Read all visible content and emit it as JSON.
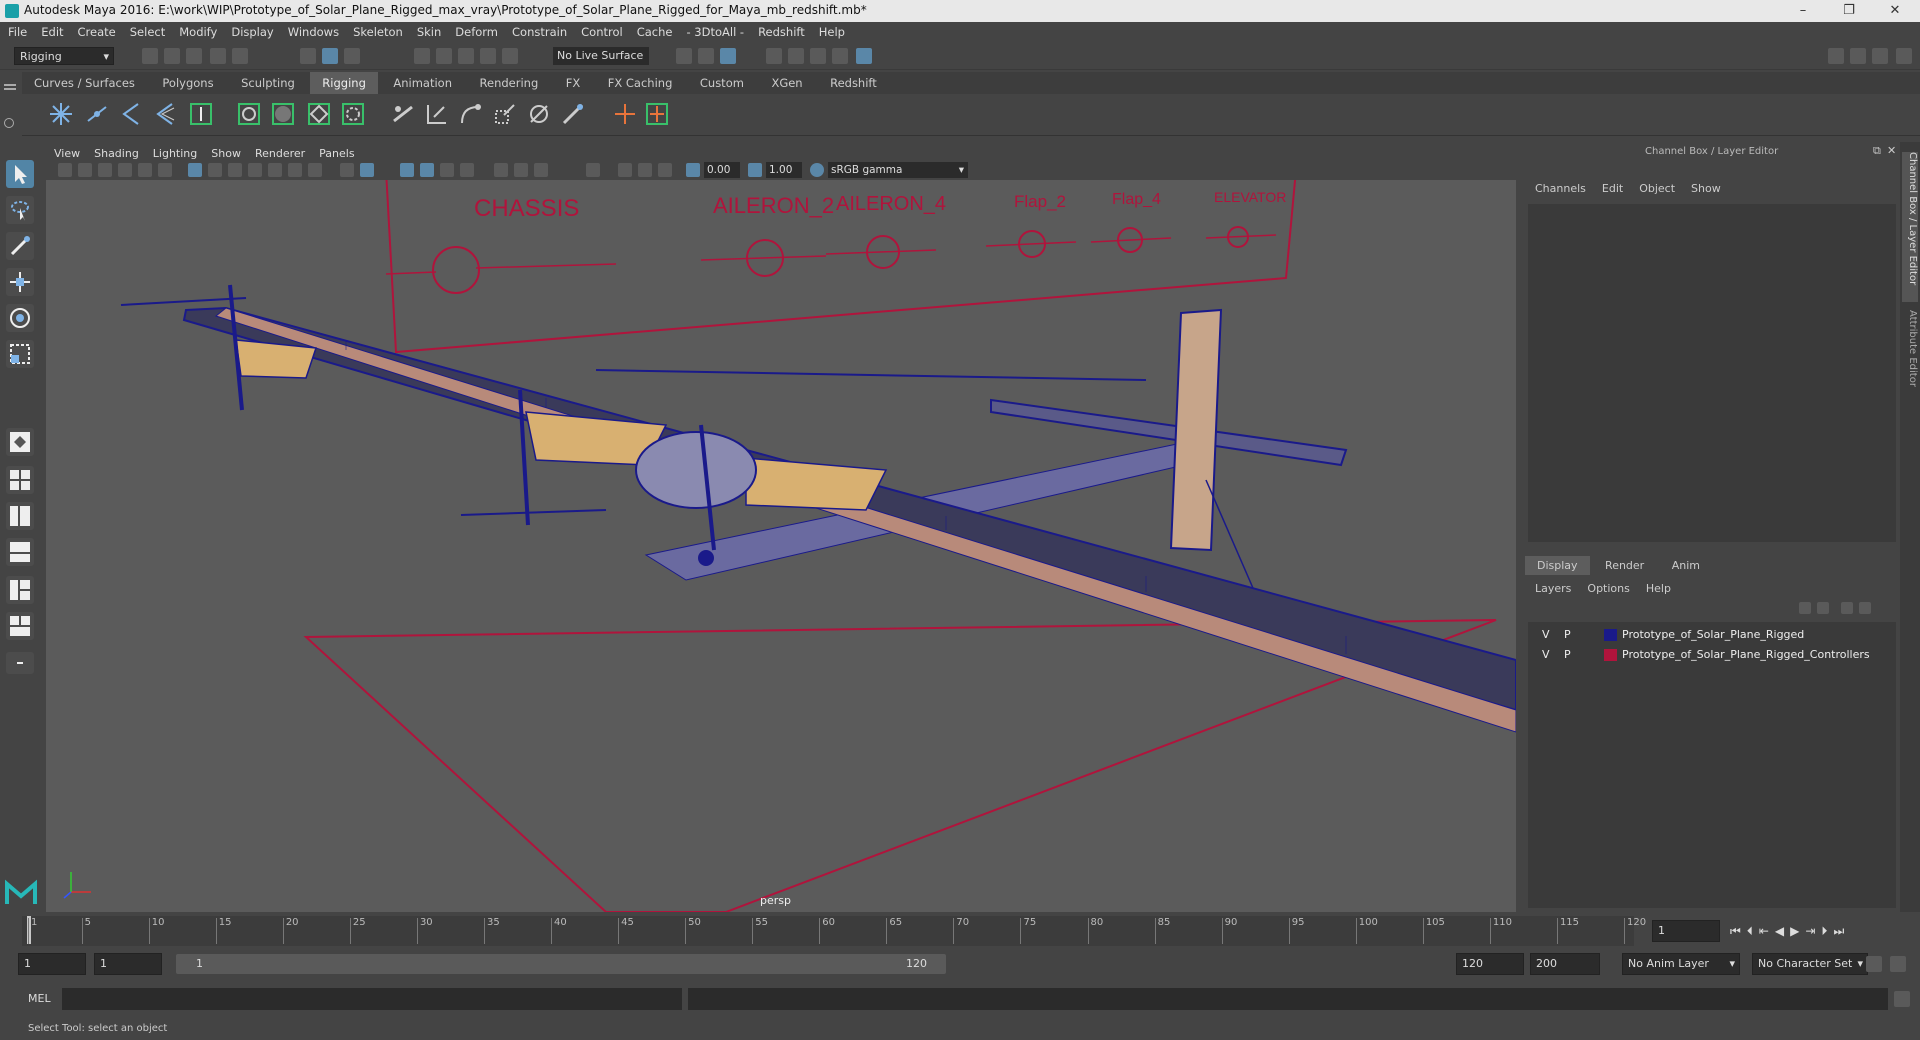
{
  "window": {
    "title": "Autodesk Maya 2016: E:\\work\\WIP\\Prototype_of_Solar_Plane_Rigged_max_vray\\Prototype_of_Solar_Plane_Rigged_for_Maya_mb_redshift.mb*"
  },
  "menubar": [
    "File",
    "Edit",
    "Create",
    "Select",
    "Modify",
    "Display",
    "Windows",
    "Skeleton",
    "Skin",
    "Deform",
    "Constrain",
    "Control",
    "Cache",
    "- 3DtoAll -",
    "Redshift",
    "Help"
  ],
  "statusline": {
    "mode": "Rigging",
    "live_surface": "No Live Surface"
  },
  "shelf_tabs": [
    "Curves / Surfaces",
    "Polygons",
    "Sculpting",
    "Rigging",
    "Animation",
    "Rendering",
    "FX",
    "FX Caching",
    "Custom",
    "XGen",
    "Redshift"
  ],
  "shelf_active": "Rigging",
  "viewport": {
    "menu": [
      "View",
      "Shading",
      "Lighting",
      "Show",
      "Renderer",
      "Panels"
    ],
    "exposure": "0.00",
    "gamma": "1.00",
    "color_space": "sRGB gamma",
    "camera_label": "persp",
    "controller_labels": [
      "CHASSIS",
      "AILERON_2",
      "AILERON_4",
      "Flap_2",
      "Flap_4",
      "ELEVATOR"
    ]
  },
  "right_panel": {
    "title": "Channel Box / Layer Editor",
    "menu": [
      "Channels",
      "Edit",
      "Object",
      "Show"
    ],
    "layer_tabs": [
      "Display",
      "Render",
      "Anim"
    ],
    "layer_tab_active": "Display",
    "layer_menu": [
      "Layers",
      "Options",
      "Help"
    ],
    "layers": [
      {
        "v": "V",
        "p": "P",
        "name": "Prototype_of_Solar_Plane_Rigged",
        "color": "#1a1a8a"
      },
      {
        "v": "V",
        "p": "P",
        "name": "Prototype_of_Solar_Plane_Rigged_Controllers",
        "color": "#b0143c"
      }
    ],
    "side_tabs": [
      "Channel Box / Layer Editor",
      "Attribute Editor"
    ]
  },
  "timeline": {
    "ticks": [
      "1",
      "5",
      "10",
      "15",
      "20",
      "25",
      "30",
      "35",
      "40",
      "45",
      "50",
      "55",
      "60",
      "65",
      "70",
      "75",
      "80",
      "85",
      "90",
      "95",
      "100",
      "105",
      "110",
      "115",
      "120"
    ],
    "current_frame": "1"
  },
  "range": {
    "start": "1",
    "playback_start": "1",
    "slider_start": "1",
    "slider_end": "120",
    "playback_end": "120",
    "end": "200",
    "anim_layer": "No Anim Layer",
    "character_set": "No Character Set"
  },
  "command": {
    "label": "MEL"
  },
  "help_line": "Select Tool: select an object"
}
